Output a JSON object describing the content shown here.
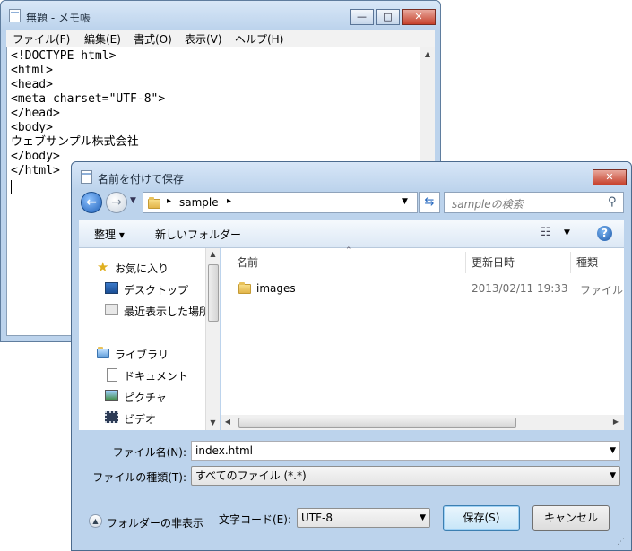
{
  "notepad": {
    "title": "無題 - メモ帳",
    "menu": [
      "ファイル(F)",
      "編集(E)",
      "書式(O)",
      "表示(V)",
      "ヘルプ(H)"
    ],
    "lines": [
      "<!DOCTYPE html>",
      "<html>",
      "<head>",
      "<meta charset=\"UTF-8\">",
      "</head>",
      "<body>",
      "ウェブサンプル株式会社",
      "</body>",
      "</html>"
    ]
  },
  "dialog": {
    "title": "名前を付けて保存",
    "address": {
      "separator": "▸",
      "folder": "sample"
    },
    "search_placeholder": "sampleの検索",
    "toolbar": {
      "organize": "整理 ▾",
      "new_folder": "新しいフォルダー"
    },
    "nav": {
      "favorites": "お気に入り",
      "favorites_items": [
        "デスクトップ",
        "最近表示した場所"
      ],
      "libraries": "ライブラリ",
      "libraries_items": [
        "ドキュメント",
        "ピクチャ",
        "ビデオ"
      ]
    },
    "columns": [
      "名前",
      "更新日時",
      "種類"
    ],
    "files": [
      {
        "name": "images",
        "modified": "2013/02/11 19:33",
        "type": "ファイル"
      }
    ],
    "filename_label": "ファイル名(N):",
    "filename_value": "index.html",
    "filetype_label": "ファイルの種類(T):",
    "filetype_value": "すべてのファイル (*.*)",
    "hide_folders": "フォルダーの非表示",
    "encoding_label": "文字コード(E):",
    "encoding_value": "UTF-8",
    "save_button": "保存(S)",
    "cancel_button": "キャンセル"
  }
}
